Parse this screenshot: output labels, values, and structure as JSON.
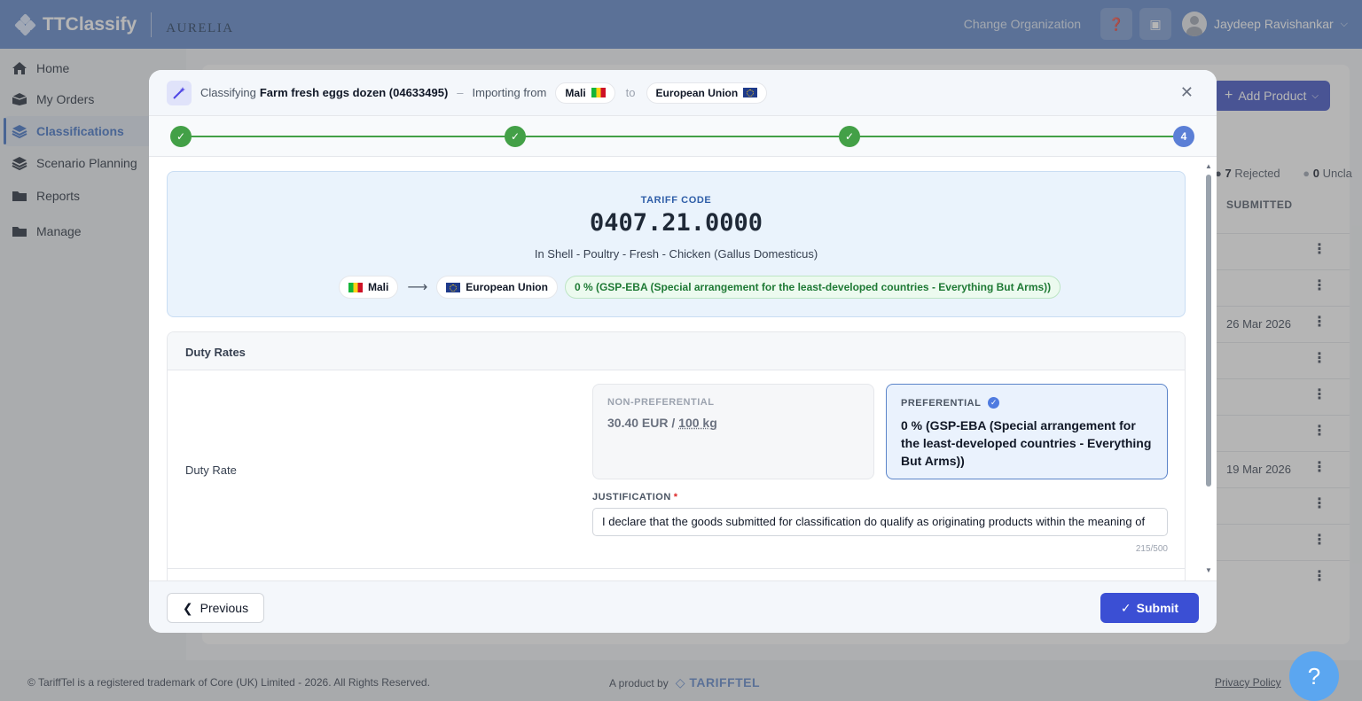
{
  "topbar": {
    "app_name": "TTClassify",
    "org_logo": "AURELIA",
    "change_org": "Change Organization",
    "user_name": "Jaydeep Ravishankar",
    "color": "#5b84c9"
  },
  "sidebar": {
    "items": [
      {
        "label": "Home",
        "icon": "home-icon"
      },
      {
        "label": "My Orders",
        "icon": "box-icon"
      },
      {
        "label": "Classifications",
        "icon": "layers-icon",
        "active": true
      },
      {
        "label": "Scenario Planning",
        "icon": "layers-icon"
      },
      {
        "label": "Reports",
        "icon": "folder-icon"
      },
      {
        "label": "Manage",
        "icon": "folder-icon"
      }
    ]
  },
  "background": {
    "add_product": "Add Product",
    "stats": {
      "rejected_count": "7",
      "rejected_label": "Rejected",
      "unclassified_count": "0",
      "unclassified_label": "Uncla"
    },
    "submitted_header": "SUBMITTED",
    "rows": [
      {
        "date": ""
      },
      {
        "date": ""
      },
      {
        "date": "26 Mar 2026"
      },
      {
        "date": ""
      },
      {
        "date": ""
      },
      {
        "date": ""
      },
      {
        "date": "19 Mar 2026"
      },
      {
        "date": ""
      },
      {
        "date": ""
      },
      {
        "date": ""
      }
    ]
  },
  "modal": {
    "header": {
      "prefix": "Classifying",
      "product": "Farm fresh eggs dozen (04633495)",
      "importing_label": "Importing from",
      "from": "Mali",
      "to_label": "to",
      "to": "European Union"
    },
    "stepper": {
      "current_step": "4",
      "completed": 3
    },
    "tariff": {
      "label": "TARIFF CODE",
      "code": "0407.21.0000",
      "description": "In Shell - Poultry - Fresh - Chicken (Gallus Domesticus)",
      "from": "Mali",
      "to": "European Union",
      "rate_chip": "0 % (GSP-EBA (Special arrangement for the least-developed countries - Everything But Arms))"
    },
    "duty_rates": {
      "title": "Duty Rates",
      "row_label": "Duty Rate",
      "non_preferential": {
        "label": "NON-PREFERENTIAL",
        "value_prefix": "30.40 EUR / ",
        "value_unit": "100 kg"
      },
      "preferential": {
        "label": "PREFERENTIAL",
        "value": "0 % (GSP-EBA (Special arrangement for the least-developed countries - Everything But Arms))"
      },
      "justification": {
        "label": "JUSTIFICATION",
        "value": "I declare that the goods submitted for classification do qualify as originating products within the meaning of",
        "counter": "215/500"
      }
    },
    "footer": {
      "previous": "Previous",
      "submit": "Submit"
    }
  },
  "footer": {
    "copyright": "© TariffTel is a registered trademark of Core (UK) Limited - 2026. All Rights Reserved.",
    "product_by": "A product by",
    "brand": "TARIFFTEL",
    "privacy": "Privacy Policy"
  }
}
